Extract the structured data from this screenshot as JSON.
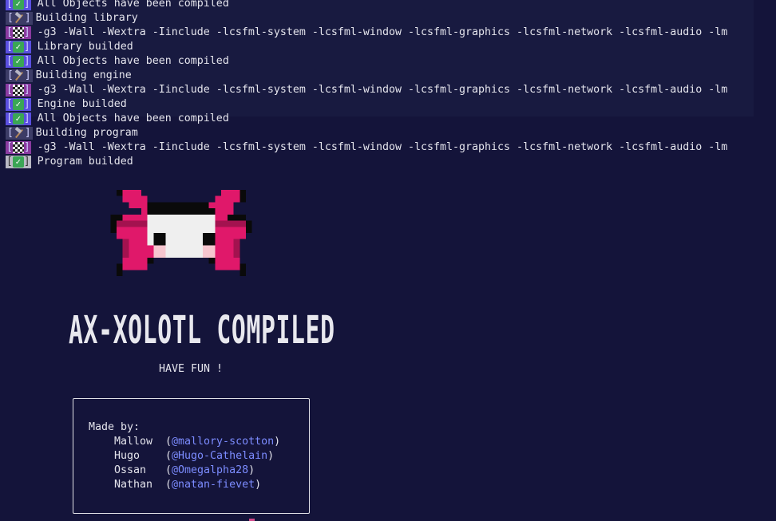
{
  "log": [
    {
      "tag": "check",
      "text": "All Objects have been compiled"
    },
    {
      "tag": "hammer",
      "text": "Building library"
    },
    {
      "tag": "flag",
      "text": "-g3 -Wall -Wextra -Iinclude -lcsfml-system -lcsfml-window -lcsfml-graphics -lcsfml-network -lcsfml-audio -lm"
    },
    {
      "tag": "check",
      "text": "Library builded"
    },
    {
      "tag": "check",
      "text": "All Objects have been compiled"
    },
    {
      "tag": "hammer",
      "text": "Building engine"
    },
    {
      "tag": "flag",
      "text": "-g3 -Wall -Wextra -Iinclude -lcsfml-system -lcsfml-window -lcsfml-graphics -lcsfml-network -lcsfml-audio -lm"
    },
    {
      "tag": "check",
      "text": "Engine builded"
    },
    {
      "tag": "check",
      "text": "All Objects have been compiled"
    },
    {
      "tag": "hammer",
      "text": "Building program"
    },
    {
      "tag": "flag",
      "text": "-g3 -Wall -Wextra -Iinclude -lcsfml-system -lcsfml-window -lcsfml-graphics -lcsfml-network -lcsfml-audio -lm"
    },
    {
      "tag": "check-last",
      "text": "Program builded"
    }
  ],
  "banner": {
    "title": "AX-XOLOTL COMPILED",
    "subtitle": "HAVE FUN !"
  },
  "credits": {
    "heading": "Made by:",
    "people": [
      {
        "name": "Mallow",
        "handle": "@mallory-scotton"
      },
      {
        "name": "Hugo",
        "handle": "@Hugo-Cathelain"
      },
      {
        "name": "Ossan",
        "handle": "@Omegalpha28"
      },
      {
        "name": "Nathan",
        "handle": "@natan-fievet"
      }
    ]
  },
  "colors": {
    "background": "#14143a",
    "axolotl_pink": "#e0186a",
    "handle_blue": "#7c8cff"
  }
}
